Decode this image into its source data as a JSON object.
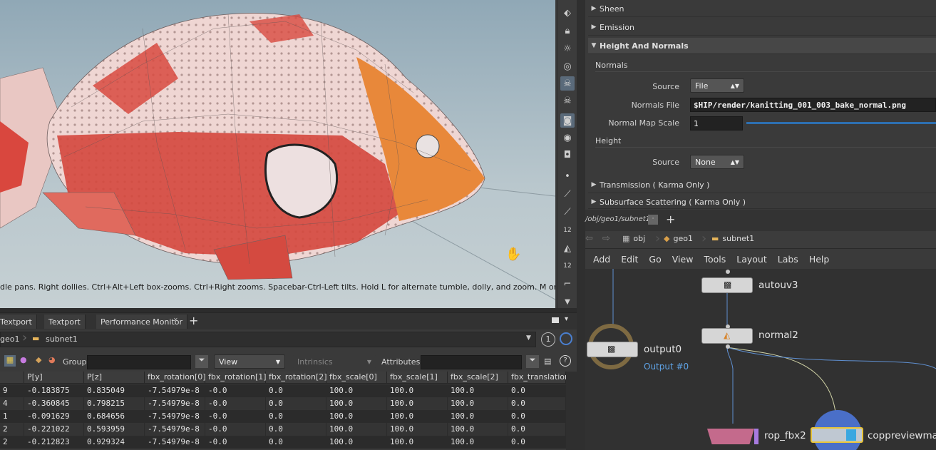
{
  "viewport": {
    "hud_text": "dle pans. Right dollies. Ctrl+Alt+Left box-zooms. Ctrl+Right zooms. Spacebar-Ctrl-Left tilts. Hold L for alternate tumble, dolly, and zoom. M or Alt+M for First"
  },
  "viewport_tools": [
    "select-tool-icon",
    "lock-icon",
    "light-bulb-icon",
    "sphere-icon",
    "skull-icon",
    "skull-icon",
    "camera-icon",
    "eye-icon",
    "camera-icon",
    "dot-icon",
    "brush-icon",
    "pin-icon",
    "counter-icon",
    "shape-icon",
    "counter-icon",
    "corner-icon",
    "arrow-down-icon"
  ],
  "params": {
    "sections": [
      {
        "label": "Sheen",
        "open": false
      },
      {
        "label": "Emission",
        "open": false
      },
      {
        "label": "Height And Normals",
        "open": true
      },
      {
        "label": "Transmission ( Karma Only )",
        "open": false
      },
      {
        "label": "Subsurface Scattering ( Karma Only )",
        "open": false
      }
    ],
    "normals_heading": "Normals",
    "source_label": "Source",
    "source_value": "File",
    "normals_file_label": "Normals File",
    "normals_file_value": "$HIP/render/kanitting_001_003_bake_normal.png",
    "normal_map_scale_label": "Normal Map Scale",
    "normal_map_scale_value": "1",
    "height_heading": "Height",
    "height_source_label": "Source",
    "height_source_value": "None"
  },
  "network": {
    "path": "/obj/geo1/subnet1",
    "crumbs": [
      "obj",
      "geo1",
      "subnet1"
    ],
    "menu": [
      "Add",
      "Edit",
      "Go",
      "View",
      "Tools",
      "Layout",
      "Labs",
      "Help"
    ],
    "nodes": {
      "autouv": "autouv3",
      "normal": "normal2",
      "output": "output0",
      "output_sub": "Output #0",
      "rop": "rop_fbx2",
      "cop": "coppreviewma"
    }
  },
  "tabs": [
    "Textport",
    "Textport",
    "Performance Monitor"
  ],
  "spreadsheet": {
    "crumbs": [
      "geo1",
      "subnet1"
    ],
    "counter": "1",
    "group_label": "Group:",
    "view_label": "View",
    "intrinsics_label": "Intrinsics",
    "attributes_label": "Attributes:",
    "columns": [
      "P[y]",
      "P[z]",
      "fbx_rotation[0]",
      "fbx_rotation[1]",
      "fbx_rotation[2]",
      "fbx_scale[0]",
      "fbx_scale[1]",
      "fbx_scale[2]",
      "fbx_translation"
    ],
    "row_prefix": [
      "9",
      "4",
      "1",
      "2",
      "2"
    ],
    "rows": [
      [
        "-0.183875",
        "0.835049",
        "-7.54979e-8",
        "-0.0",
        "0.0",
        "100.0",
        "100.0",
        "100.0",
        "0.0"
      ],
      [
        "-0.360845",
        "0.798215",
        "-7.54979e-8",
        "-0.0",
        "0.0",
        "100.0",
        "100.0",
        "100.0",
        "0.0"
      ],
      [
        "-0.091629",
        "0.684656",
        "-7.54979e-8",
        "-0.0",
        "0.0",
        "100.0",
        "100.0",
        "100.0",
        "0.0"
      ],
      [
        "-0.221022",
        "0.593959",
        "-7.54979e-8",
        "-0.0",
        "0.0",
        "100.0",
        "100.0",
        "100.0",
        "0.0"
      ],
      [
        "-0.212823",
        "0.929324",
        "-7.54979e-8",
        "-0.0",
        "0.0",
        "100.0",
        "100.0",
        "100.0",
        "0.0"
      ]
    ]
  }
}
